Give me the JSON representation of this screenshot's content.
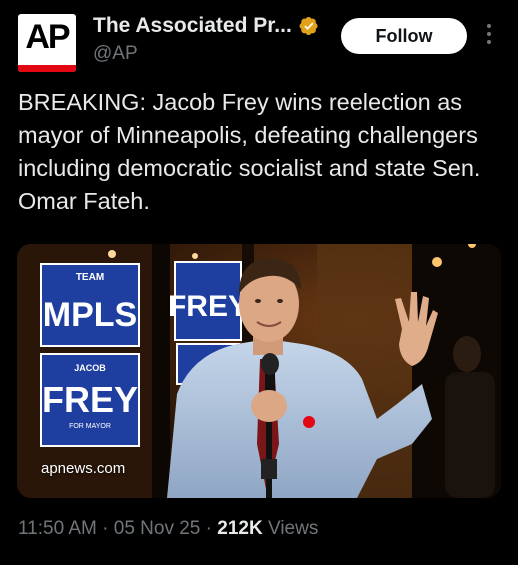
{
  "author": {
    "avatar_text": "AP",
    "display_name": "The Associated Pr...",
    "handle": "@AP",
    "verified_badge_color": "#e2a21b"
  },
  "follow_button": {
    "label": "Follow"
  },
  "more_icon": "more-vertical-icon",
  "tweet": {
    "text": "BREAKING: Jacob Frey wins reelection as mayor of Minneapolis, defeating challengers including democratic socialist and state Sen. Omar Fateh."
  },
  "media": {
    "link_domain": "apnews.com",
    "sign_texts": {
      "sign1_small": "TEAM",
      "sign1_big": "MPLS",
      "sign2_big": "FREY",
      "sign3_small": "JACOB",
      "sign3_big": "FREY",
      "sign3_sub": "FOR MAYOR"
    }
  },
  "meta": {
    "time": "11:50 AM",
    "separator": "·",
    "date": "05 Nov 25",
    "views_count": "212K",
    "views_label": "Views"
  },
  "colors": {
    "background": "#000000",
    "text_primary": "#e7e9ea",
    "text_secondary": "#71767b",
    "ap_red": "#e30613",
    "sign_blue": "#1f3fa0"
  }
}
